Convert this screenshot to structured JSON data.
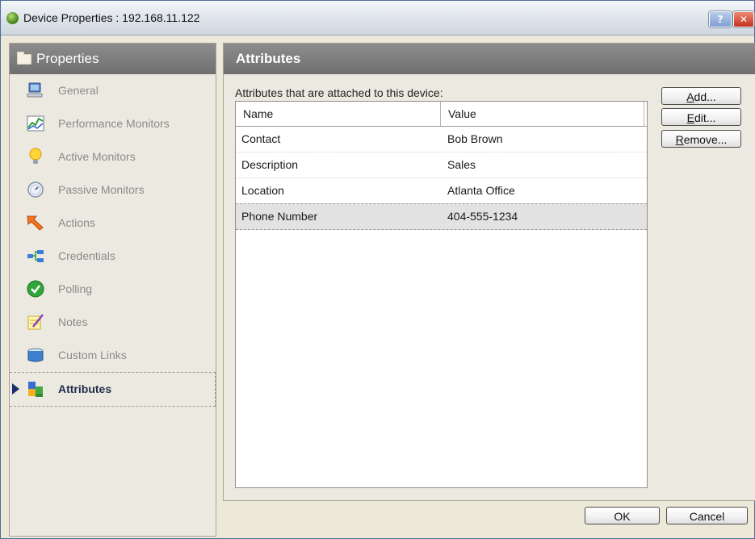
{
  "window": {
    "title": "Device Properties : 192.168.11.122",
    "help_glyph": "?",
    "close_glyph": "✕"
  },
  "sidebar": {
    "header": "Properties",
    "items": [
      {
        "label": "General",
        "icon": "computer-icon",
        "selected": false
      },
      {
        "label": "Performance Monitors",
        "icon": "chart-icon",
        "selected": false
      },
      {
        "label": "Active Monitors",
        "icon": "lightbulb-icon",
        "selected": false
      },
      {
        "label": "Passive Monitors",
        "icon": "gauge-icon",
        "selected": false
      },
      {
        "label": "Actions",
        "icon": "arrow-icon",
        "selected": false
      },
      {
        "label": "Credentials",
        "icon": "network-icon",
        "selected": false
      },
      {
        "label": "Polling",
        "icon": "checkmark-icon",
        "selected": false
      },
      {
        "label": "Notes",
        "icon": "notepad-icon",
        "selected": false
      },
      {
        "label": "Custom Links",
        "icon": "jar-icon",
        "selected": false
      },
      {
        "label": "Attributes",
        "icon": "blocks-icon",
        "selected": true
      }
    ]
  },
  "main": {
    "header": "Attributes",
    "caption": "Attributes that are attached to this device:",
    "columns": [
      "Name",
      "Value"
    ],
    "rows": [
      {
        "name": "Contact",
        "value": "Bob Brown",
        "selected": false
      },
      {
        "name": "Description",
        "value": "Sales",
        "selected": false
      },
      {
        "name": "Location",
        "value": "Atlanta Office",
        "selected": false
      },
      {
        "name": "Phone Number",
        "value": "404-555-1234",
        "selected": true
      }
    ]
  },
  "buttons": {
    "add": {
      "mnemonic": "A",
      "rest": "dd..."
    },
    "edit": {
      "mnemonic": "E",
      "rest": "dit..."
    },
    "remove": {
      "mnemonic": "R",
      "rest": "emove..."
    },
    "ok": "OK",
    "cancel": "Cancel"
  }
}
